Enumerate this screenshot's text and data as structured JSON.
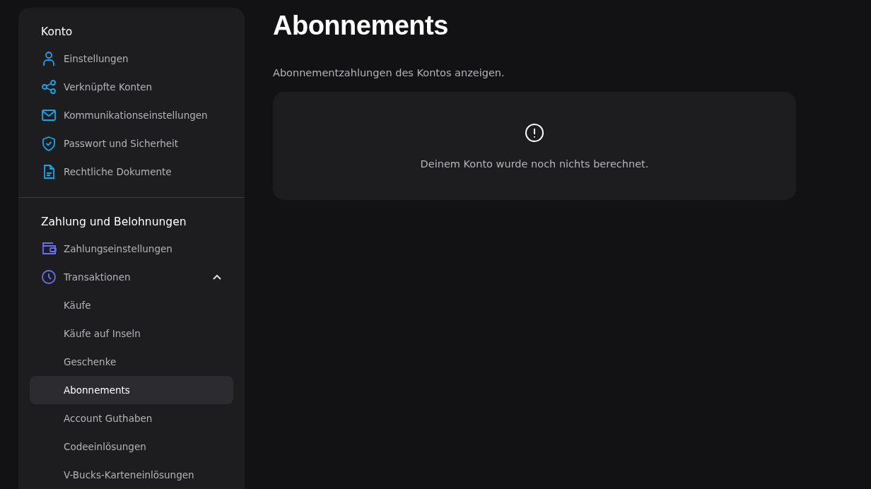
{
  "sidebar": {
    "sections": [
      {
        "heading": "Konto",
        "items": [
          {
            "label": "Einstellungen",
            "kind": "user",
            "selected": false
          },
          {
            "label": "Verknüpfte Konten",
            "kind": "share",
            "selected": false
          },
          {
            "label": "Kommunikationseinstellungen",
            "kind": "mail",
            "selected": false
          },
          {
            "label": "Passwort und Sicherheit",
            "kind": "shield",
            "selected": false
          },
          {
            "label": "Rechtliche Dokumente",
            "kind": "document",
            "selected": false
          }
        ]
      },
      {
        "heading": "Zahlung und Belohnungen",
        "items": [
          {
            "label": "Zahlungseinstellungen",
            "kind": "wallet",
            "selected": false
          },
          {
            "label": "Transaktionen",
            "kind": "clock",
            "selected": false,
            "expanded": true,
            "children": [
              {
                "label": "Käufe",
                "selected": false
              },
              {
                "label": "Käufe auf Inseln",
                "selected": false
              },
              {
                "label": "Geschenke",
                "selected": false
              },
              {
                "label": "Abonnements",
                "selected": true
              },
              {
                "label": "Account Guthaben",
                "selected": false
              },
              {
                "label": "Codeeinlösungen",
                "selected": false
              },
              {
                "label": "V-Bucks-Karteneinlösungen",
                "selected": false
              }
            ]
          }
        ]
      }
    ]
  },
  "main": {
    "title": "Abonnements",
    "subtitle": "Abonnementzahlungen des Kontos anzeigen.",
    "empty_message": "Deinem Konto wurde noch nichts berechnet."
  }
}
